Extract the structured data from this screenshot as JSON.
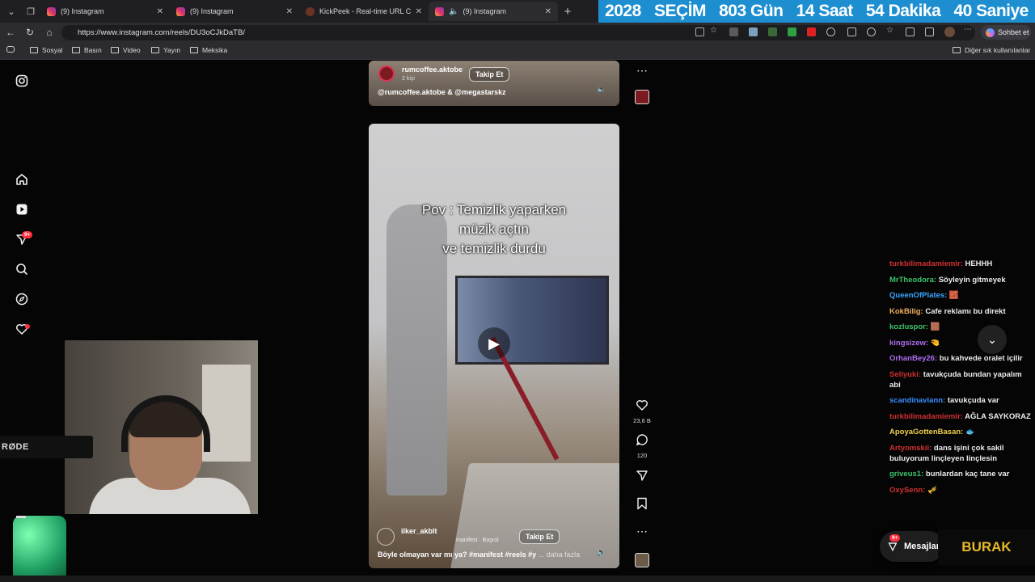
{
  "browser": {
    "tabs": [
      {
        "title": "(9) Instagram",
        "icon": "instagram-icon"
      },
      {
        "title": "(9) Instagram",
        "icon": "instagram-icon"
      },
      {
        "title": "KickPeek - Real-time URL Crawler",
        "icon": "kickpeek-icon"
      },
      {
        "title": "(9) Instagram",
        "icon": "instagram-icon",
        "active": true
      }
    ],
    "new_tab": "+",
    "url": "https://www.instagram.com/reels/DU3oCJkDaTB/",
    "copilot_label": "Sohbet et",
    "bookmarks": [
      "Sosyal",
      "Basın",
      "Video",
      "Yayın",
      "Meksika"
    ],
    "other_bookmarks": "Diğer sık kullanılanlar"
  },
  "countdown": {
    "year": "2028",
    "label": "SEÇİM",
    "days": "803 Gün",
    "hours": "14 Saat",
    "minutes": "54 Dakika",
    "seconds": "40 Saniye",
    "background": "#1d8ed0"
  },
  "sidebar": {
    "notification_badge": "9+"
  },
  "reel_top": {
    "username": "rumcoffee.aktobe",
    "subline": "2 kişi",
    "follow": "Takip Et",
    "caption": "@rumcoffee.aktobe & @megastarskz"
  },
  "reel_main": {
    "overlay_line1": "Pov : Temizlik yaparken",
    "overlay_line2": "müzik açtın",
    "overlay_line3": "ve temizlik durdu",
    "username": "ilker_akblt",
    "audio": "manifest · Başrol",
    "follow": "Takip Et",
    "caption": "Böyle olmayan var mı ya? #manifest #reels #y",
    "more": "... daha fazla",
    "likes": "23,6 B",
    "comments": "120"
  },
  "webcam": {
    "mic_brand": "RØDE"
  },
  "chat": {
    "messages": [
      {
        "user": "turkbilimadamiemir:",
        "text": "HEHHH",
        "color": "#d03030"
      },
      {
        "user": "MrTheodora:",
        "text": "Söyleyin gitmeyek",
        "color": "#3cc46a"
      },
      {
        "user": "QueenOfPlates:",
        "text": "🧱",
        "color": "#3aa7ff"
      },
      {
        "user": "KokBilig:",
        "text": "Cafe reklamı bu direkt",
        "color": "#f0b060"
      },
      {
        "user": "kozluspor:",
        "text": "🟫",
        "color": "#3cc46a"
      },
      {
        "user": "kingsizew:",
        "text": "🤏",
        "color": "#b06cf0"
      },
      {
        "user": "OrhanBey26:",
        "text": "bu kahvede oralet içilir",
        "color": "#b06cf0"
      },
      {
        "user": "Seliyuki:",
        "text": "tavukçuda bundan yapalım abi",
        "color": "#d03030"
      },
      {
        "user": "scandinaviann:",
        "text": "tavukçuda var",
        "color": "#3a8cff"
      },
      {
        "user": "turkbilimadamiemir:",
        "text": "AĞLA SAYKORAZ",
        "color": "#d03030"
      },
      {
        "user": "ApoyaGottenBasan:",
        "text": "🐟",
        "color": "#f0d050"
      },
      {
        "user": "Artyomskii:",
        "text": "dans işini çok sakil buluyorum linçleyen linçlesin",
        "color": "#d03030"
      },
      {
        "user": "griveus1:",
        "text": "bunlardan kaç tane var",
        "color": "#3cc46a"
      },
      {
        "user": "OxySenn:",
        "text": "🎺",
        "color": "#d03030"
      }
    ]
  },
  "messages_button": {
    "label": "Mesajlar",
    "badge": "9+"
  },
  "overlay_brand": "BURAK"
}
